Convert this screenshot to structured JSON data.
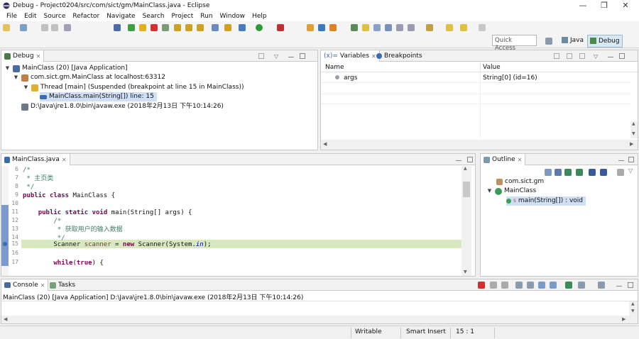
{
  "window": {
    "title": "Debug - Project0204/src/com/sict/gm/MainClass.java - Eclipse",
    "minimize": "—",
    "maximize": "❐",
    "close": "✕"
  },
  "menu": [
    "File",
    "Edit",
    "Source",
    "Refactor",
    "Navigate",
    "Search",
    "Project",
    "Run",
    "Window",
    "Help"
  ],
  "toolbar": {
    "quick_access_placeholder": "Quick Access",
    "perspectives": {
      "java": "Java",
      "debug": "Debug"
    }
  },
  "debug_view": {
    "tab_label": "Debug",
    "tree": {
      "launch": "MainClass (20) [Java Application]",
      "target": "com.sict.gm.MainClass at localhost:63312",
      "thread": "Thread [main] (Suspended (breakpoint at line 15 in MainClass))",
      "frame": "MainClass.main(String[]) line: 15",
      "process": "D:\\Java\\jre1.8.0\\bin\\javaw.exe (2018年2月13日 下午10:14:26)"
    }
  },
  "variables_view": {
    "tab_variables": "Variables",
    "tab_breakpoints": "Breakpoints",
    "columns": {
      "name": "Name",
      "value": "Value"
    },
    "rows": [
      {
        "name": "args",
        "value": "String[0]  (id=16)"
      }
    ]
  },
  "editor": {
    "tab_label": "MainClass.java",
    "lines": [
      {
        "num": "6",
        "text": "/*"
      },
      {
        "num": "7",
        "text": " * 主页类"
      },
      {
        "num": "8",
        "text": " */"
      },
      {
        "num": "9",
        "text": "public class MainClass {"
      },
      {
        "num": "10",
        "text": ""
      },
      {
        "num": "11",
        "text": "    public static void main(String[] args) {"
      },
      {
        "num": "12",
        "text": "        /*"
      },
      {
        "num": "13",
        "text": "         * 获取用户的输入数据"
      },
      {
        "num": "14",
        "text": "         */"
      },
      {
        "num": "15",
        "text": "        Scanner scanner = new Scanner(System.in);"
      },
      {
        "num": "16",
        "text": ""
      },
      {
        "num": "17",
        "text": "        while(true) {"
      }
    ]
  },
  "outline_view": {
    "tab_label": "Outline",
    "items": {
      "package": "com.sict.gm",
      "class": "MainClass",
      "method": "main(String[]) : void",
      "method_modifier": "S"
    }
  },
  "console_view": {
    "tab_console": "Console",
    "tab_tasks": "Tasks",
    "process_label": "MainClass (20) [Java Application] D:\\Java\\jre1.8.0\\bin\\javaw.exe (2018年2月13日 下午10:14:26)"
  },
  "status_bar": {
    "writable": "Writable",
    "insert_mode": "Smart Insert",
    "position": "15 : 1"
  },
  "colors": {
    "current_line": "#d8e8c0",
    "selection": "#cfe0f5",
    "keyword": "#7f0055",
    "comment": "#3f7f5f"
  }
}
